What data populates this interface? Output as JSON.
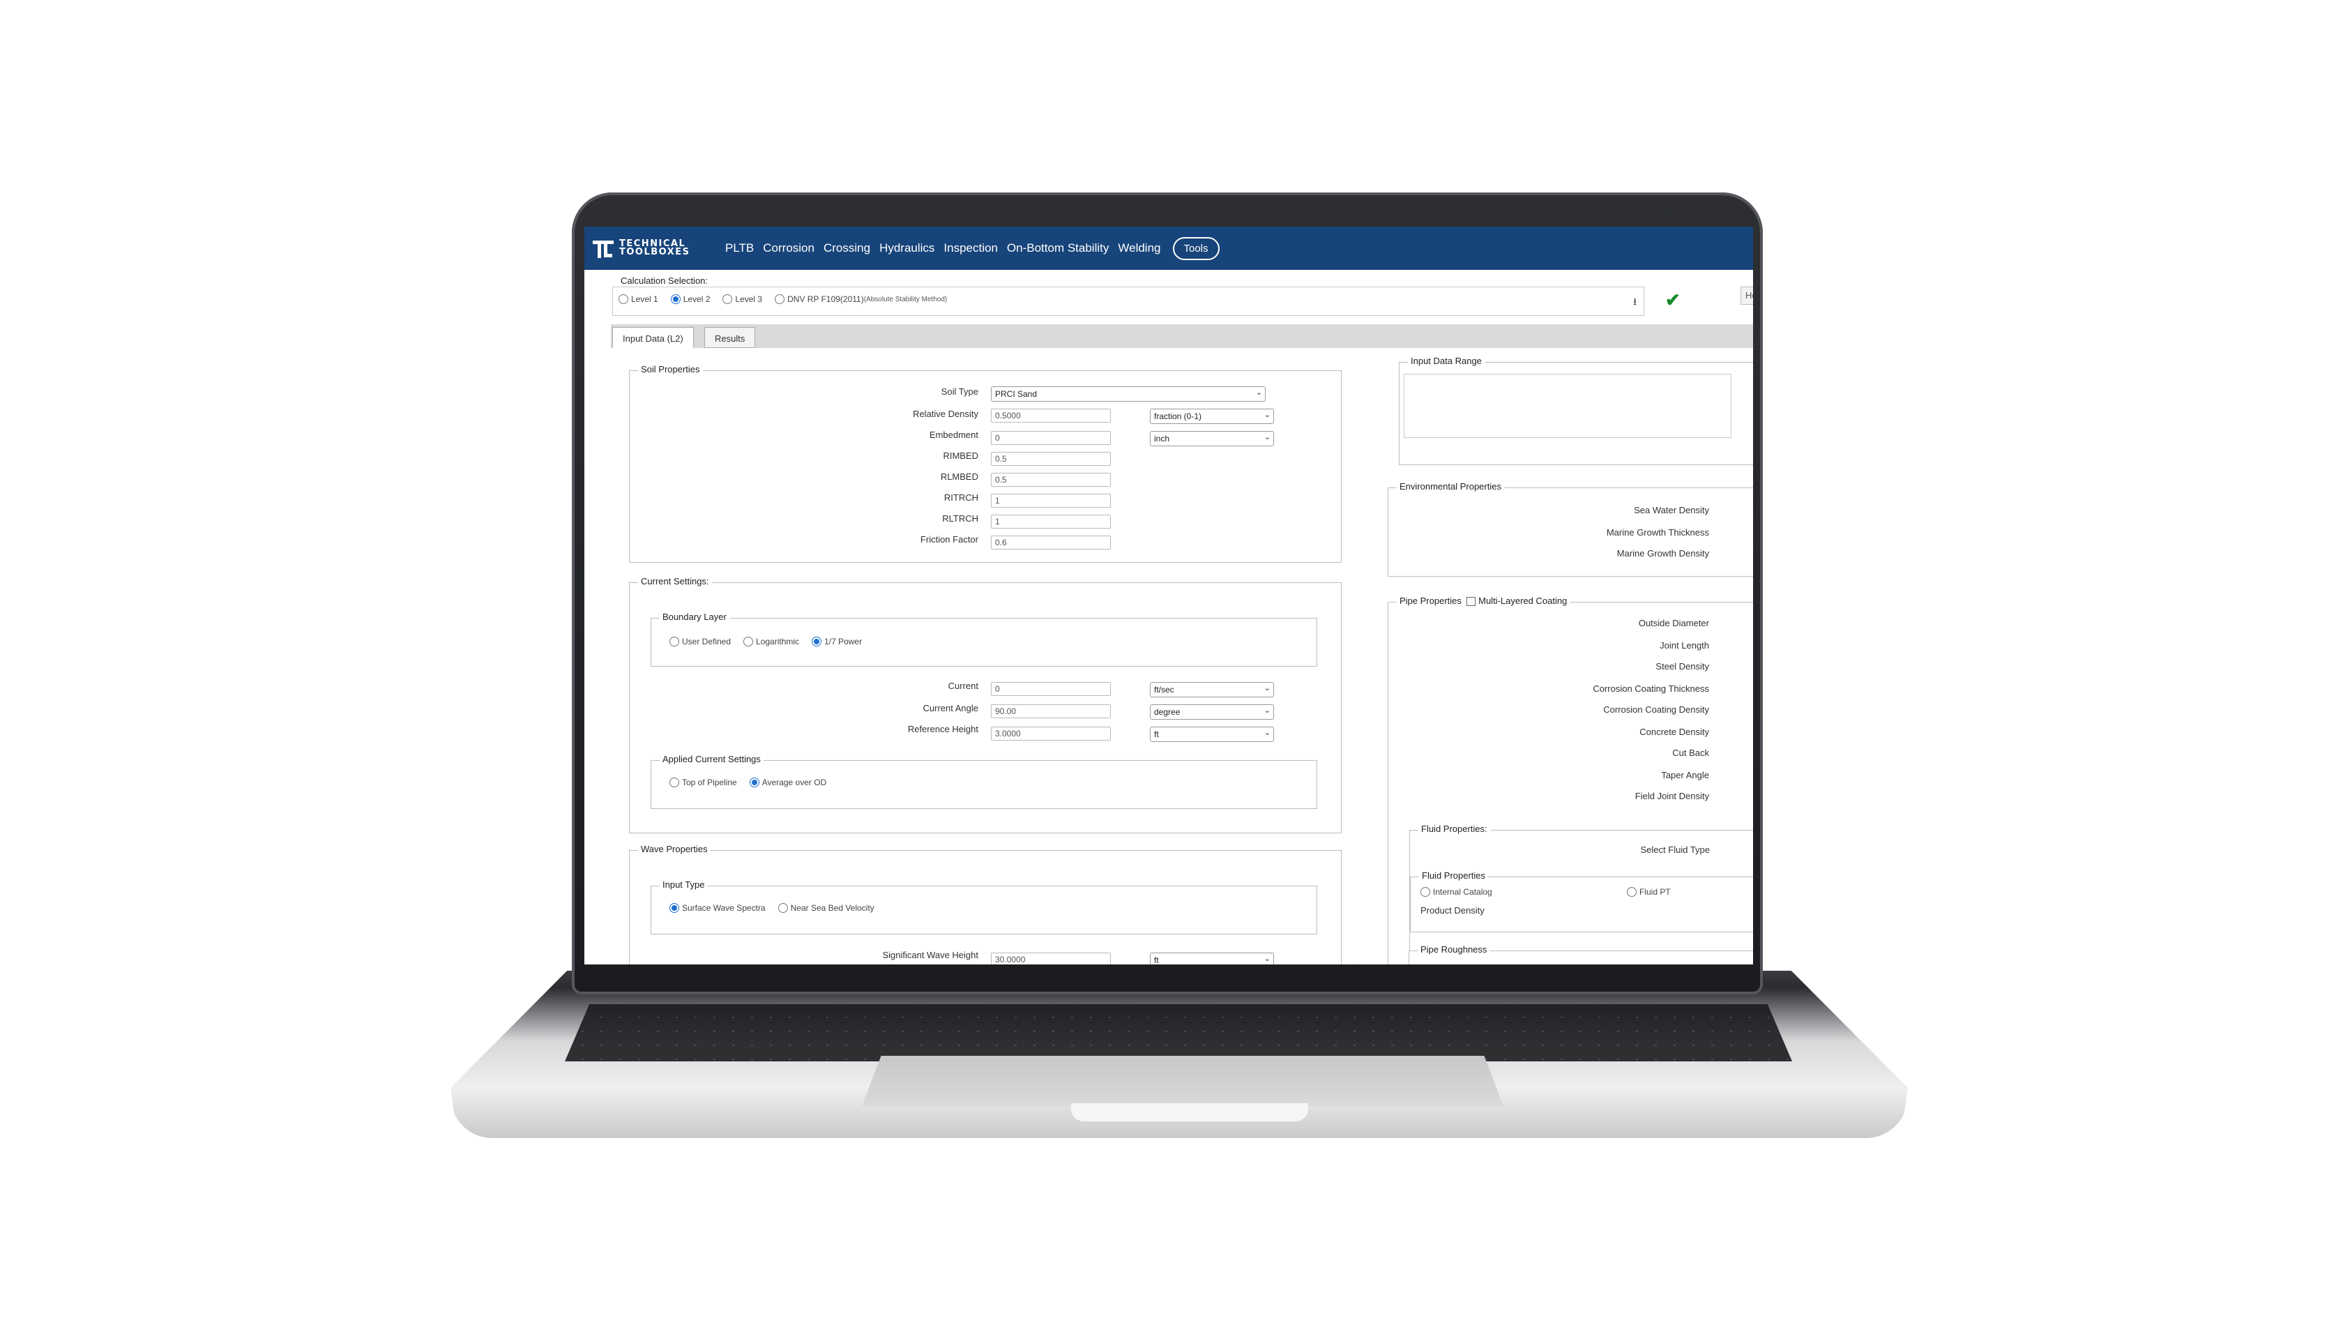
{
  "nav": {
    "brand_line1": "TECHNICAL",
    "brand_line2": "TOOLBOXES",
    "items": [
      "PLTB",
      "Corrosion",
      "Crossing",
      "Hydraulics",
      "Inspection",
      "On-Bottom Stability",
      "Welding"
    ],
    "tools": "Tools"
  },
  "calc": {
    "label": "Calculation Selection:",
    "options": [
      "Level 1",
      "Level 2",
      "Level 3",
      "DNV RP F109(2011)"
    ],
    "dnv_note": "(Absolute Stability Method)",
    "selected": "Level 2",
    "hor_button": "Hor. Fa"
  },
  "tabs": [
    "Input Data (L2)",
    "Results"
  ],
  "soil": {
    "legend": "Soil Properties",
    "soil_type_label": "Soil Type",
    "soil_type_value": "PRCI Sand",
    "rows": [
      {
        "label": "Relative Density",
        "value": "0.5000",
        "unit": "fraction (0-1)"
      },
      {
        "label": "Embedment",
        "value": "0",
        "unit": "inch"
      },
      {
        "label": "RIMBED",
        "value": "0.5"
      },
      {
        "label": "RLMBED",
        "value": "0.5"
      },
      {
        "label": "RITRCH",
        "value": "1"
      },
      {
        "label": "RLTRCH",
        "value": "1"
      },
      {
        "label": "Friction Factor",
        "value": "0.6"
      }
    ]
  },
  "current": {
    "legend": "Current Settings:",
    "boundary_legend": "Boundary Layer",
    "boundary_options": [
      "User Defined",
      "Logarithmic",
      "1/7 Power"
    ],
    "rows": [
      {
        "label": "Current",
        "value": "0",
        "unit": "ft/sec"
      },
      {
        "label": "Current Angle",
        "value": "90.00",
        "unit": "degree"
      },
      {
        "label": "Reference Height",
        "value": "3.0000",
        "unit": "ft"
      }
    ],
    "applied_legend": "Applied Current Settings",
    "applied_options": [
      "Top of Pipeline",
      "Average over OD"
    ]
  },
  "wave": {
    "legend": "Wave Properties",
    "input_type_legend": "Input Type",
    "input_options": [
      "Surface Wave Spectra",
      "Near Sea Bed Velocity"
    ],
    "sig_label": "Significant Wave Height",
    "sig_value": "30.0000",
    "sig_unit": "ft"
  },
  "right": {
    "range_legend": "Input Data Range",
    "env_legend": "Environmental Properties",
    "env_rows": [
      "Sea Water Density",
      "Marine Growth Thickness",
      "Marine Growth Density"
    ],
    "pipe_legend": "Pipe Properties",
    "multi_layer": "Multi-Layered Coating",
    "pipe_rows": [
      "Outside Diameter",
      "Joint Length",
      "Steel Density",
      "Corrosion Coating Thickness",
      "Corrosion Coating Density",
      "Concrete Density",
      "Cut Back",
      "Taper Angle",
      "Field Joint Density"
    ],
    "fluid_legend": "Fluid Properties:",
    "select_fluid": "Select Fluid Type",
    "fluid_inner_legend": "Fluid Properties",
    "fluid_options": [
      "Internal Catalog",
      "Fluid PT"
    ],
    "product_density": "Product Density",
    "roughness_legend": "Pipe Roughness"
  }
}
